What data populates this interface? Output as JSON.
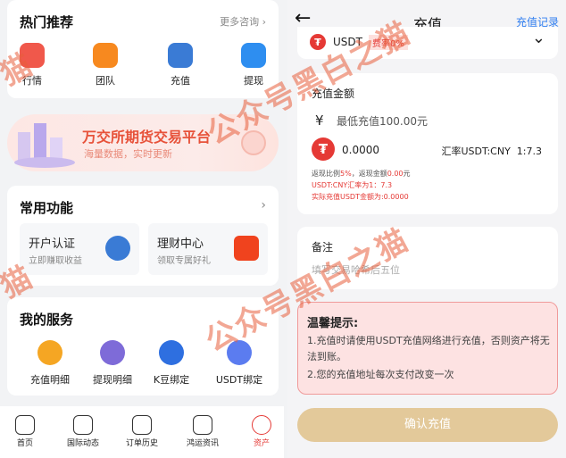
{
  "left": {
    "hot": {
      "title": "热门推荐",
      "more": "更多咨询",
      "items": [
        {
          "label": "行情",
          "color": "#f0584b",
          "icon": "chart-icon"
        },
        {
          "label": "团队",
          "color": "#f7891f",
          "icon": "team-icon"
        },
        {
          "label": "充值",
          "color": "#3a7bd5",
          "icon": "recharge-icon"
        },
        {
          "label": "提现",
          "color": "#2e8ef0",
          "icon": "withdraw-icon"
        }
      ]
    },
    "banner": {
      "title": "万交所期货交易平台",
      "subtitle": "海量数据，实时更新"
    },
    "common": {
      "title": "常用功能",
      "cards": [
        {
          "title": "开户认证",
          "sub": "立即赚取收益",
          "color": "#3a7bd5",
          "icon": "id-icon"
        },
        {
          "title": "理财中心",
          "sub": "领取专属好礼",
          "color": "#f0431e",
          "icon": "gift-icon"
        }
      ]
    },
    "services": {
      "title": "我的服务",
      "items": [
        {
          "label": "充值明细",
          "color": "#f5a623",
          "icon": "question-icon"
        },
        {
          "label": "提现明细",
          "color": "#7e6bd8",
          "icon": "withdraw-detail-icon"
        },
        {
          "label": "K豆绑定",
          "color": "#2e6fe0",
          "icon": "swap-icon"
        },
        {
          "label": "USDT绑定",
          "color": "#5b7cf0",
          "icon": "swap-icon"
        }
      ]
    },
    "tabs": [
      {
        "label": "首页",
        "icon": "home-icon"
      },
      {
        "label": "国际动态",
        "icon": "chart-icon"
      },
      {
        "label": "订单历史",
        "icon": "currency-icon"
      },
      {
        "label": "鸿运资讯",
        "icon": "people-icon"
      },
      {
        "label": "资产",
        "icon": "user-icon",
        "active": true
      }
    ]
  },
  "right": {
    "header": {
      "title": "充值",
      "back": "←",
      "record": "充值记录"
    },
    "currency": {
      "name": "USDT",
      "tag": "费率0%",
      "arrow": "⌄",
      "logo": "₮"
    },
    "amount": {
      "title": "充值金额",
      "symbol": "¥",
      "placeholder": "最低充值100.00元",
      "usdt_value": "0.0000",
      "rate": "汇率USDT:CNY  1:7.3",
      "logo": "₮",
      "info1_prefix": "返现比例",
      "info1_pct": "5%",
      "info1_mid": "，返现金额",
      "info1_val": "0.00",
      "info1_suffix": "元",
      "info2": "USDT:CNY汇率为1：7.3",
      "info3": "实际充值USDT金额为:0.0000"
    },
    "note": {
      "title": "备注",
      "placeholder": "填写交易哈希后五位"
    },
    "tips": {
      "title": "温馨提示:",
      "line1": "1.充值时请使用USDT充值网络进行充值，否则资产将无法到账。",
      "line2": "2.您的充值地址每次支付改变一次"
    },
    "confirm": "确认充值"
  },
  "watermark": "公众号黑白之猫",
  "watermark_short": "猫"
}
